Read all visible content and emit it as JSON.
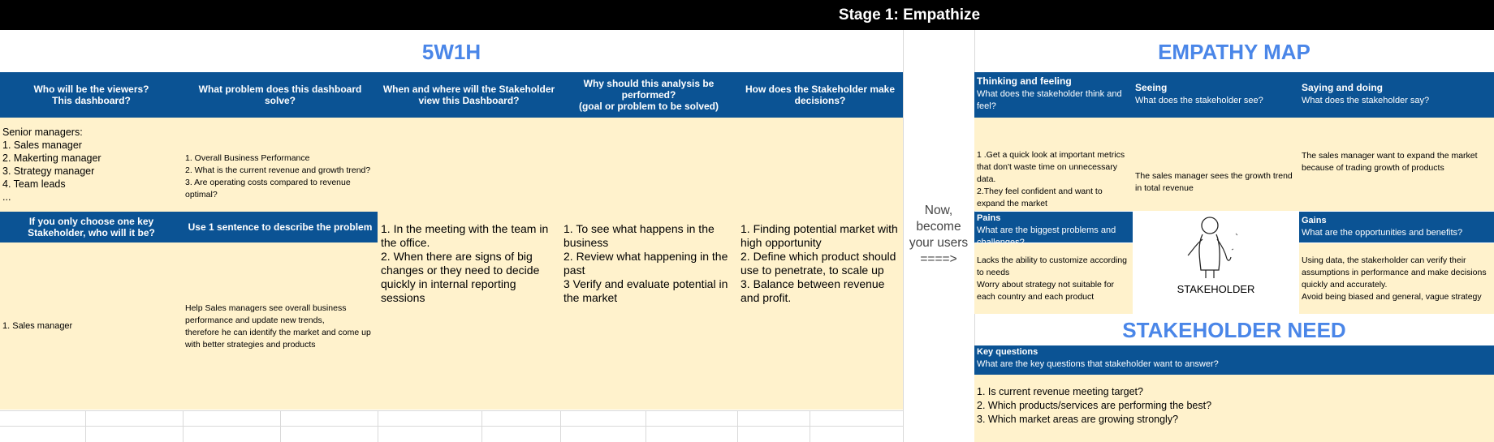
{
  "stage_title": "Stage 1: Empathize",
  "w5h1": {
    "title": "5W1H",
    "headers": [
      "Who will be the viewers?\nThis dashboard?",
      "What problem does this dashboard solve?",
      "When and where will the Stakeholder view this Dashboard?",
      "Why should this analysis be performed?\n(goal or problem to be solved)",
      "How does the Stakeholder make decisions?"
    ],
    "viewers": "Senior managers:\n1. Sales manager\n2. Makerting manager\n3. Strategy manager\n4. Team leads\n...",
    "problems": "1. Overall Business Performance\n2. What is the current revenue and growth trend?\n3. Are operating costs compared to revenue optimal?",
    "when_where": "1. In the meeting with the team in the office.\n2. When there are signs of big changes or they need to decide quickly in internal reporting sessions",
    "why": "1. To see what happens in the business\n2. Review what happening in the past\n3 Verify and evaluate potential in the market",
    "how": "1. Finding potential market with high opportunity\n2. Define which product should use to penetrate, to scale up\n3. Balance between revenue and profit.",
    "key_stakeholder_header": "If you only choose one key Stakeholder, who will it be?",
    "one_sentence_header": "Use 1 sentence to describe the problem",
    "key_stakeholder": "1. Sales manager",
    "one_sentence": "Help Sales managers see overall business performance and update new trends,\n therefore he can identify the market and come up with better strategies and products"
  },
  "transition": "Now,\nbecome\nyour users\n====>",
  "empathy_map": {
    "title": "EMPATHY MAP",
    "thinking": {
      "label": "Thinking and feeling",
      "question": "What does the stakeholder think and feel?",
      "answer": "1 .Get a quick look at important metrics that don't waste time on unnecessary data.\n2.They feel confident and want to expand the market"
    },
    "seeing": {
      "label": "Seeing",
      "question": "What does the stakeholder see?",
      "answer": "The sales manager sees the growth trend in total revenue"
    },
    "saying": {
      "label": "Saying and doing",
      "question": "What does the stakeholder say?",
      "answer": "The sales manager want to expand the market because of trading growth of products"
    },
    "pains": {
      "label": "Pains",
      "question": "What are the biggest problems and challenges?",
      "answer": "Lacks the ability to customize according to needs\nWorry about strategy not suitable for each country and each product"
    },
    "stakeholder_label": "STAKEHOLDER",
    "gains": {
      "label": "Gains",
      "question": "What are the opportunities and benefits?",
      "answer": "Using data, the stakerholder can verify their assumptions in performance and make decisions quickly and accurately.\nAvoid being biased and general, vague strategy"
    }
  },
  "stakeholder_need": {
    "title": "STAKEHOLDER NEED",
    "label": "Key questions",
    "question": "What are the key questions that stakeholder want to answer?",
    "answer": "1. Is current revenue meeting target?\n2. Which products/services are performing the best?\n3. Which market areas are growing strongly?"
  }
}
